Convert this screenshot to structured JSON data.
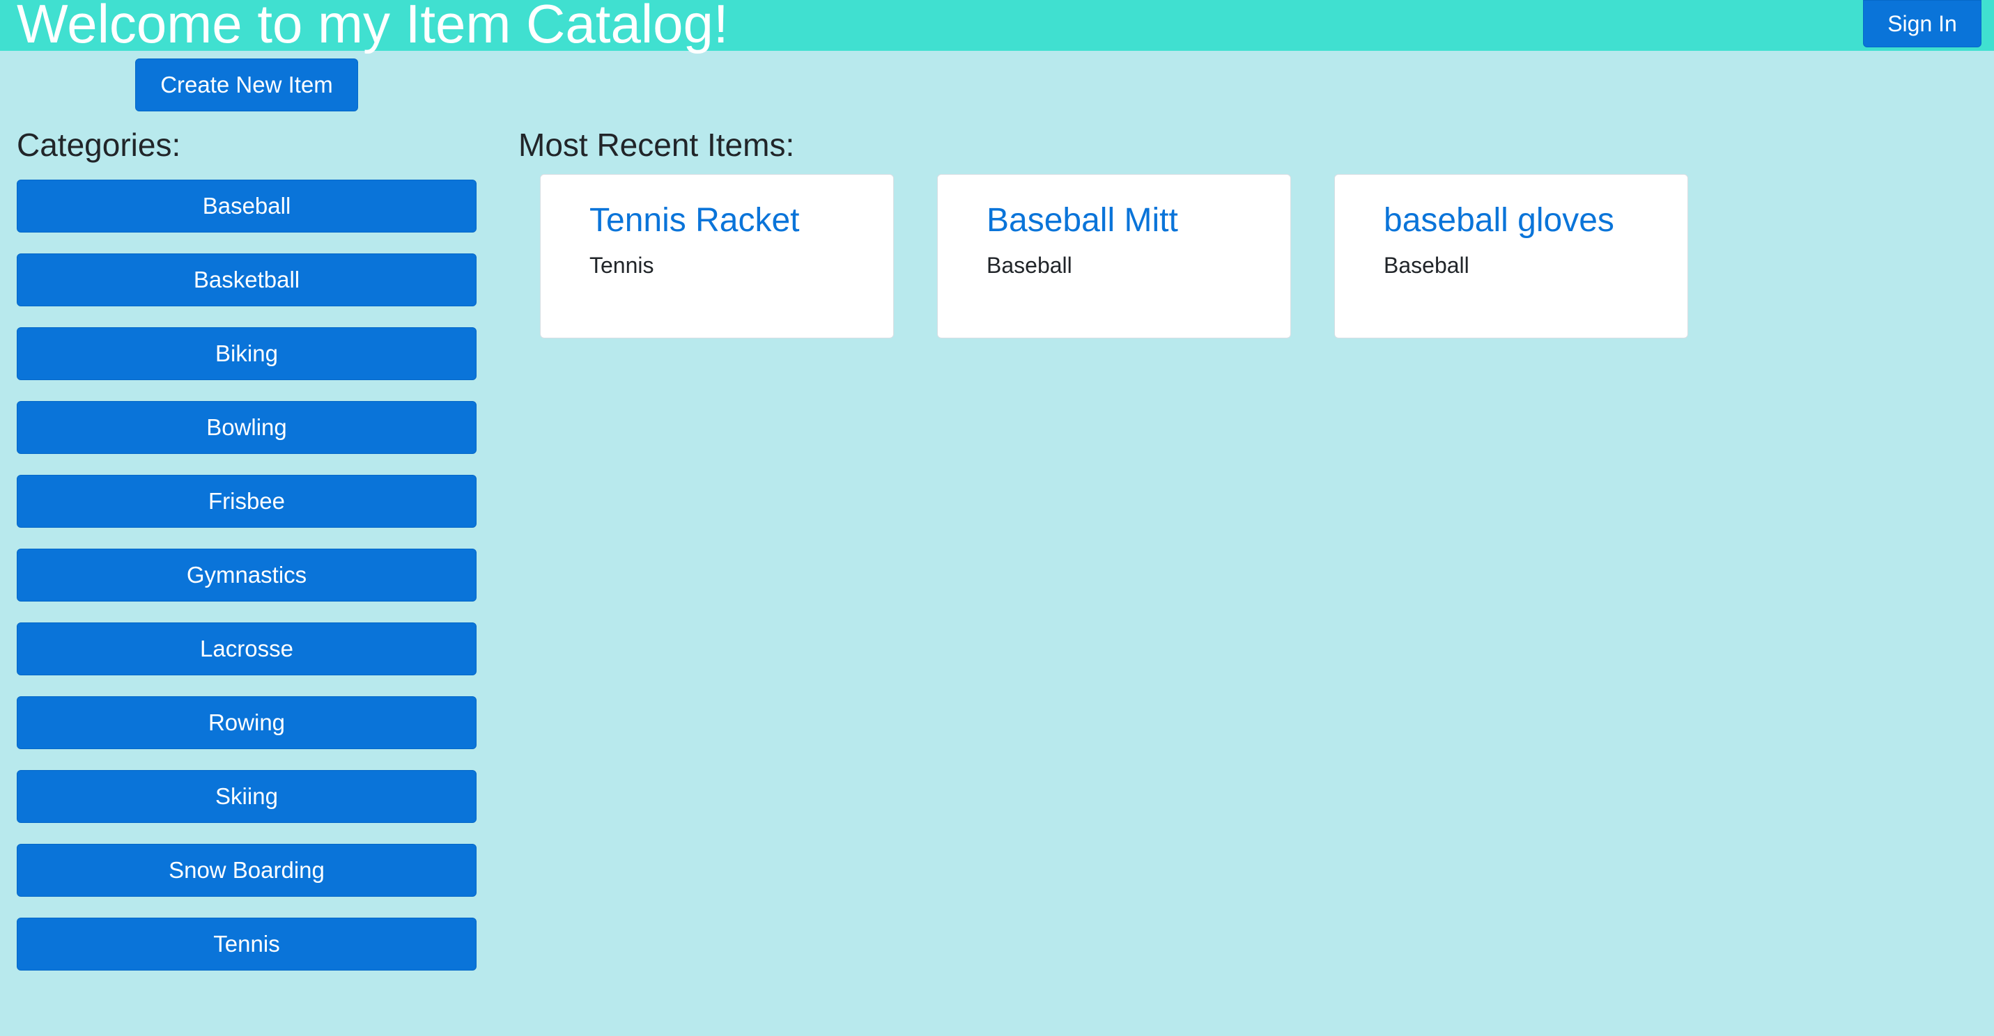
{
  "header": {
    "title": "Welcome to my Item Catalog!",
    "sign_in_label": "Sign In"
  },
  "actions": {
    "create_label": "Create New Item"
  },
  "categories": {
    "heading": "Categories:",
    "items": [
      "Baseball",
      "Basketball",
      "Biking",
      "Bowling",
      "Frisbee",
      "Gymnastics",
      "Lacrosse",
      "Rowing",
      "Skiing",
      "Snow Boarding",
      "Tennis"
    ]
  },
  "recent": {
    "heading": "Most Recent Items:",
    "items": [
      {
        "title": "Tennis Racket",
        "category": "Tennis"
      },
      {
        "title": "Baseball Mitt",
        "category": "Baseball"
      },
      {
        "title": "baseball gloves",
        "category": "Baseball"
      }
    ]
  },
  "colors": {
    "page_background": "#b8e9ed",
    "header_background": "#40e0d0",
    "button": "#0a74d9",
    "link": "#0a74d9"
  }
}
